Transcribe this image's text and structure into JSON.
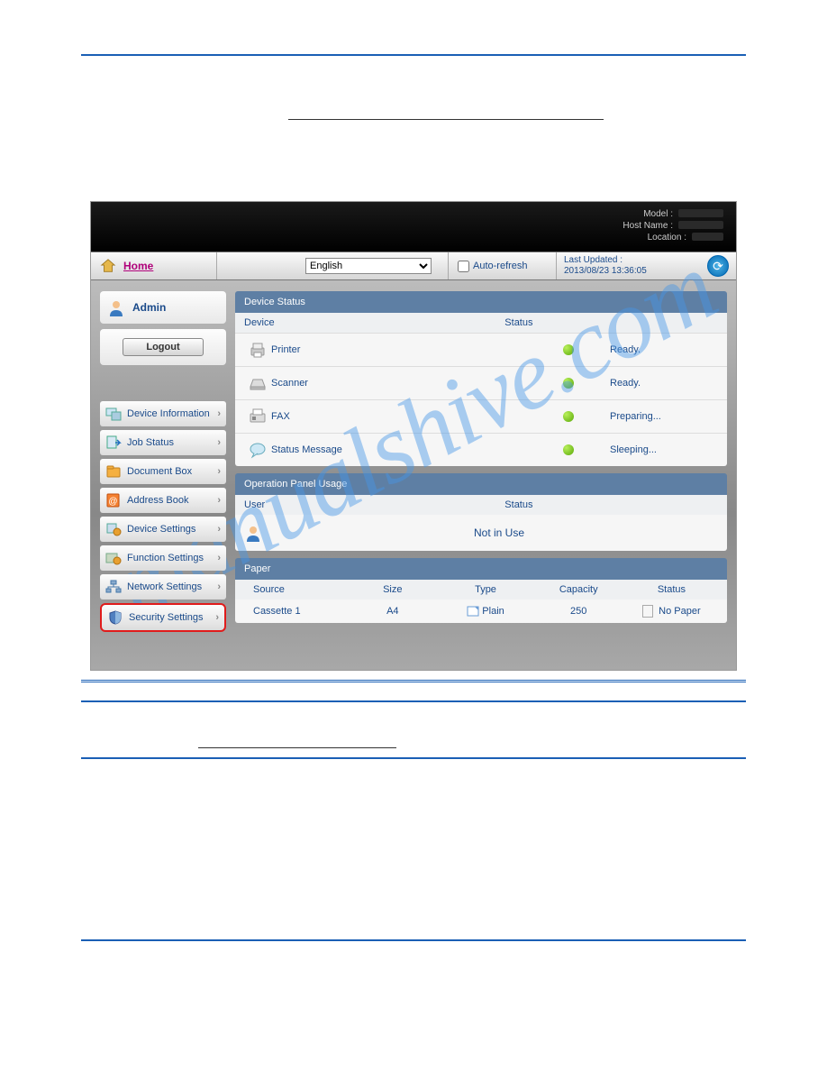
{
  "header": {
    "model_label": "Model :",
    "hostname_label": "Host Name :",
    "location_label": "Location :"
  },
  "topbar": {
    "home": "Home",
    "language": "English",
    "auto_refresh": "Auto-refresh",
    "last_updated_label": "Last Updated :",
    "last_updated_value": "2013/08/23 13:36:05"
  },
  "user": {
    "name": "Admin",
    "logout": "Logout"
  },
  "nav": [
    {
      "label": "Device Information"
    },
    {
      "label": "Job Status"
    },
    {
      "label": "Document Box"
    },
    {
      "label": "Address Book"
    },
    {
      "label": "Device Settings"
    },
    {
      "label": "Function Settings"
    },
    {
      "label": "Network Settings"
    },
    {
      "label": "Security Settings"
    }
  ],
  "device_status": {
    "title": "Device Status",
    "col_device": "Device",
    "col_status": "Status",
    "rows": [
      {
        "device": "Printer",
        "status": "Ready."
      },
      {
        "device": "Scanner",
        "status": "Ready."
      },
      {
        "device": "FAX",
        "status": "Preparing..."
      },
      {
        "device": "Status Message",
        "status": "Sleeping..."
      }
    ]
  },
  "op_panel": {
    "title": "Operation Panel Usage",
    "col_user": "User",
    "col_status": "Status",
    "status": "Not in Use"
  },
  "paper": {
    "title": "Paper",
    "cols": {
      "source": "Source",
      "size": "Size",
      "type": "Type",
      "capacity": "Capacity",
      "status": "Status"
    },
    "rows": [
      {
        "source": "Cassette 1",
        "size": "A4",
        "type": "Plain",
        "capacity": "250",
        "status": "No Paper"
      }
    ]
  },
  "watermark": "manualshive.com"
}
